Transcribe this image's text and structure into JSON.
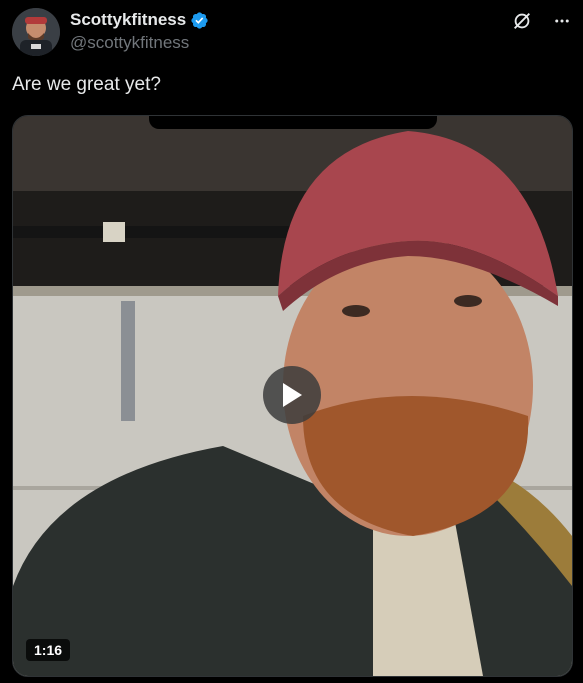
{
  "author": {
    "display_name": "Scottykfitness",
    "handle": "@scottykfitness",
    "verified_icon": "verified-badge-icon",
    "avatar_icon": "avatar"
  },
  "actions": {
    "grok_icon": "grok-icon",
    "more_icon": "more-icon"
  },
  "tweet": {
    "text": "Are we great yet?"
  },
  "media": {
    "type": "video",
    "duration": "1:16",
    "play_icon": "play-icon"
  },
  "colors": {
    "background": "#000000",
    "text_primary": "#e7e9ea",
    "text_secondary": "#71767b",
    "verified_blue": "#1d9bf0"
  }
}
